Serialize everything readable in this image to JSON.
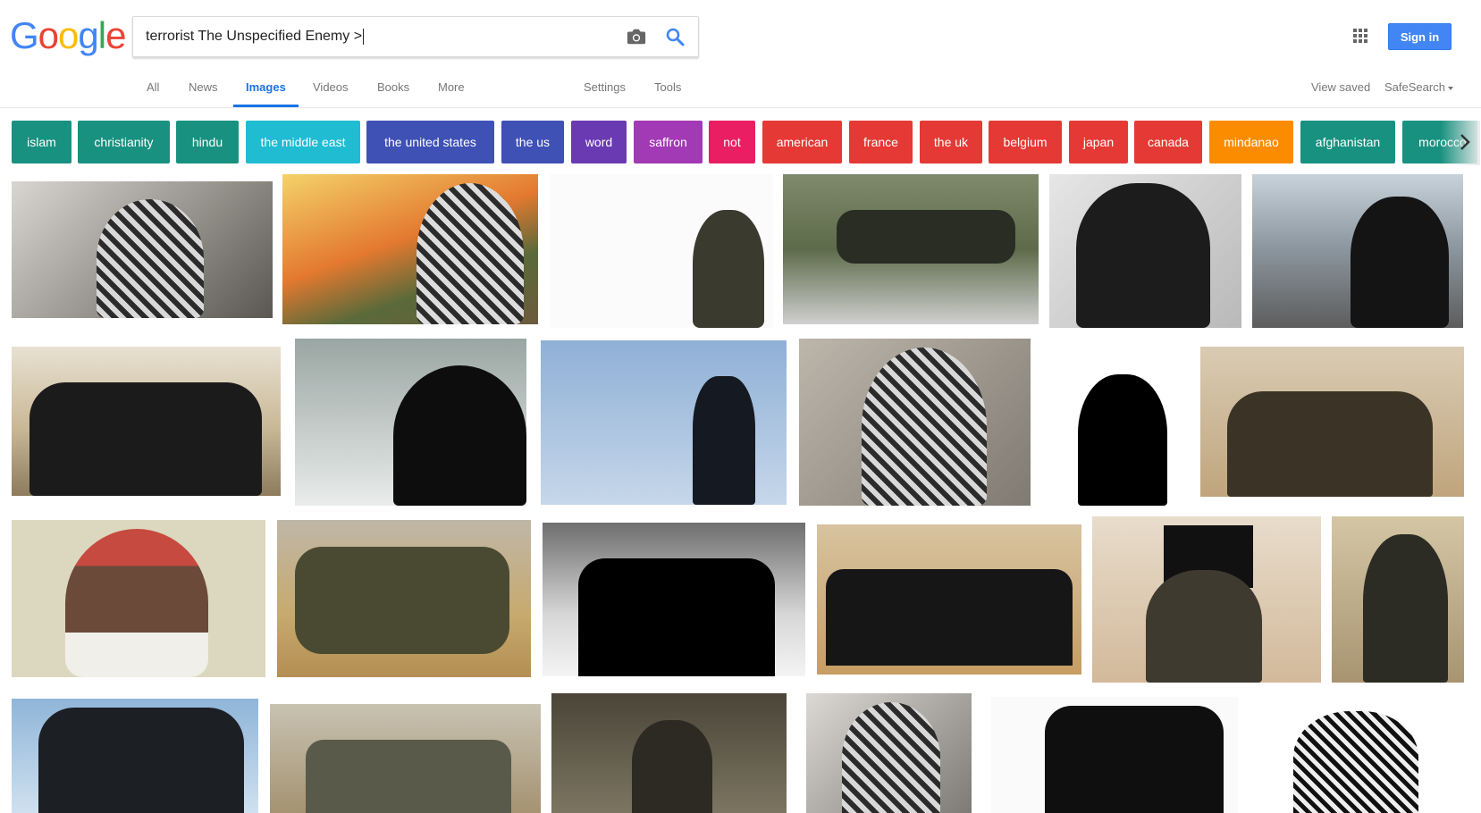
{
  "logo": {
    "letters": [
      "G",
      "o",
      "o",
      "g",
      "l",
      "e"
    ]
  },
  "search": {
    "query": "terrorist The Unspecified Enemy >",
    "camera_icon": "camera-icon",
    "search_icon": "magnifier-icon"
  },
  "header": {
    "sign_in_label": "Sign in",
    "apps_icon": "grid-apps-icon"
  },
  "tabs": {
    "items": [
      {
        "label": "All"
      },
      {
        "label": "News"
      },
      {
        "label": "Images",
        "active": true
      },
      {
        "label": "Videos"
      },
      {
        "label": "Books"
      },
      {
        "label": "More"
      }
    ],
    "settings": "Settings",
    "tools": "Tools",
    "view_saved": "View saved",
    "safesearch": "SafeSearch"
  },
  "chips": [
    {
      "label": "islam",
      "color": "#199180"
    },
    {
      "label": "christianity",
      "color": "#199180"
    },
    {
      "label": "hindu",
      "color": "#199180"
    },
    {
      "label": "the middle east",
      "color": "#1fbcd2"
    },
    {
      "label": "the united states",
      "color": "#3f51b5"
    },
    {
      "label": "the us",
      "color": "#3f51b5"
    },
    {
      "label": "word",
      "color": "#6a3ab2"
    },
    {
      "label": "saffron",
      "color": "#a239b5"
    },
    {
      "label": "not",
      "color": "#e91e63"
    },
    {
      "label": "american",
      "color": "#e53935"
    },
    {
      "label": "france",
      "color": "#e53935"
    },
    {
      "label": "the uk",
      "color": "#e53935"
    },
    {
      "label": "belgium",
      "color": "#e53935"
    },
    {
      "label": "japan",
      "color": "#e53935"
    },
    {
      "label": "canada",
      "color": "#e53935"
    },
    {
      "label": "mindanao",
      "color": "#fb8c00"
    },
    {
      "label": "afghanistan",
      "color": "#199180"
    },
    {
      "label": "morocco",
      "color": "#199180"
    }
  ],
  "colors": {
    "accent": "#1a73e8",
    "signin": "#4285f4"
  }
}
